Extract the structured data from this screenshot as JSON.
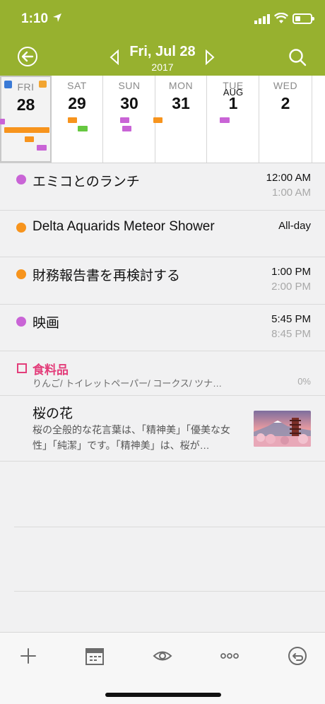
{
  "status": {
    "time": "1:10"
  },
  "header": {
    "date": "Fri, Jul 28",
    "year": "2017"
  },
  "week": [
    {
      "name": "FRI",
      "num": "28",
      "month": ""
    },
    {
      "name": "SAT",
      "num": "29",
      "month": ""
    },
    {
      "name": "SUN",
      "num": "30",
      "month": ""
    },
    {
      "name": "MON",
      "num": "31",
      "month": ""
    },
    {
      "name": "TUE",
      "num": "1",
      "month": "AUG"
    },
    {
      "name": "WED",
      "num": "2",
      "month": ""
    }
  ],
  "colors": {
    "header": "#97b12f",
    "purple": "#c964d6",
    "orange": "#f7941d",
    "green": "#66c840",
    "pink": "#e33d7a",
    "blue": "#3a7ad6"
  },
  "events": [
    {
      "title": "エミコとのランチ",
      "start": "12:00 AM",
      "end": "1:00 AM",
      "color": "#c964d6"
    },
    {
      "title": "Delta Aquarids Meteor Shower",
      "start": "All-day",
      "end": "",
      "color": "#f7941d"
    },
    {
      "title": "財務報告書を再検討する",
      "start": "1:00 PM",
      "end": "2:00 PM",
      "color": "#f7941d"
    },
    {
      "title": "映画",
      "start": "5:45 PM",
      "end": "8:45 PM",
      "color": "#c964d6"
    }
  ],
  "todo": {
    "title": "食料品",
    "items": "りんご/ トイレットペーパー/ コークス/ ツナ…",
    "progress": "0%"
  },
  "memo": {
    "title": "桜の花",
    "body": "桜の全般的な花言葉は、「精神美」「優美な女性」「純潔」です。「精神美」は、桜が…"
  },
  "toolbar": {
    "icons": [
      "plus-icon",
      "calendar-icon",
      "eye-icon",
      "more-icon",
      "undo-icon"
    ]
  }
}
